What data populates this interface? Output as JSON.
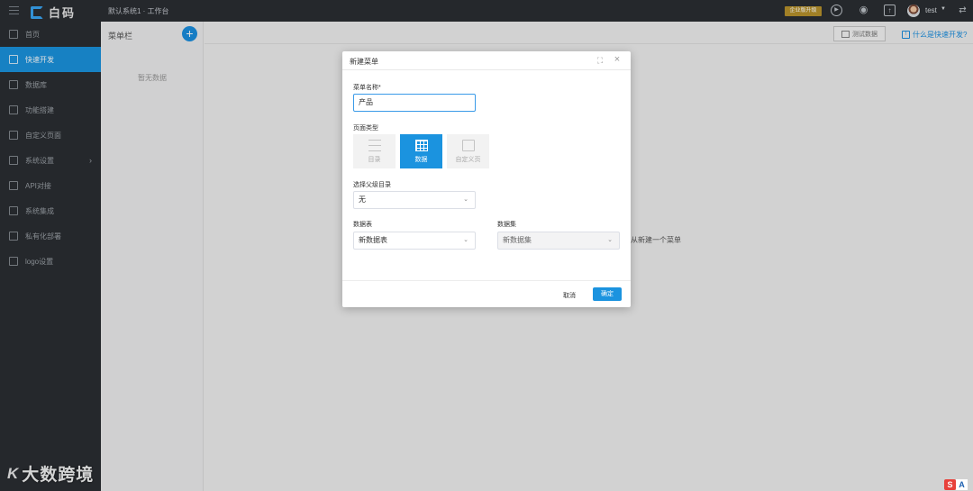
{
  "topbar": {
    "logo_text": "白码",
    "breadcrumb": "默认系统1 · 工作台",
    "upgrade_badge": "企业版升级",
    "user_name": "test"
  },
  "sidenav": {
    "items": [
      {
        "label": "首页",
        "icon": "home-icon"
      },
      {
        "label": "快速开发",
        "icon": "cube-icon",
        "active": true
      },
      {
        "label": "数据库",
        "icon": "database-icon"
      },
      {
        "label": "功能搭建",
        "icon": "build-icon"
      },
      {
        "label": "自定义页面",
        "icon": "page-icon"
      },
      {
        "label": "系统设置",
        "icon": "settings-icon",
        "has_arrow": true
      },
      {
        "label": "API对接",
        "icon": "api-icon"
      },
      {
        "label": "系统集成",
        "icon": "integration-icon"
      },
      {
        "label": "私有化部署",
        "icon": "server-icon"
      },
      {
        "label": "logo设置",
        "icon": "logo-icon"
      }
    ],
    "watermark": "大数跨境"
  },
  "menu_panel": {
    "title": "菜单栏",
    "empty_text": "暂无数据"
  },
  "main": {
    "test_data_button": "测试数据",
    "help_link": "什么是快速开发?",
    "behind_text": "从新建一个菜单"
  },
  "dialog": {
    "title": "新建菜单",
    "menu_name_label": "菜单名称*",
    "menu_name_value": "产品",
    "page_type_label": "页面类型",
    "page_types": [
      {
        "label": "目录",
        "icon": "list-icon"
      },
      {
        "label": "数据",
        "icon": "grid-icon",
        "selected": true
      },
      {
        "label": "自定义页",
        "icon": "custom-page-icon"
      }
    ],
    "parent_label": "选择父级目录",
    "parent_value": "无",
    "table_label": "数据表",
    "table_value": "新数据表",
    "dataset_label": "数据集",
    "dataset_value": "新数据集",
    "cancel_label": "取消",
    "ok_label": "确定"
  },
  "colors": {
    "accent": "#1b93df",
    "sidebar_bg": "#2b2e33",
    "badge": "#b8922c"
  }
}
